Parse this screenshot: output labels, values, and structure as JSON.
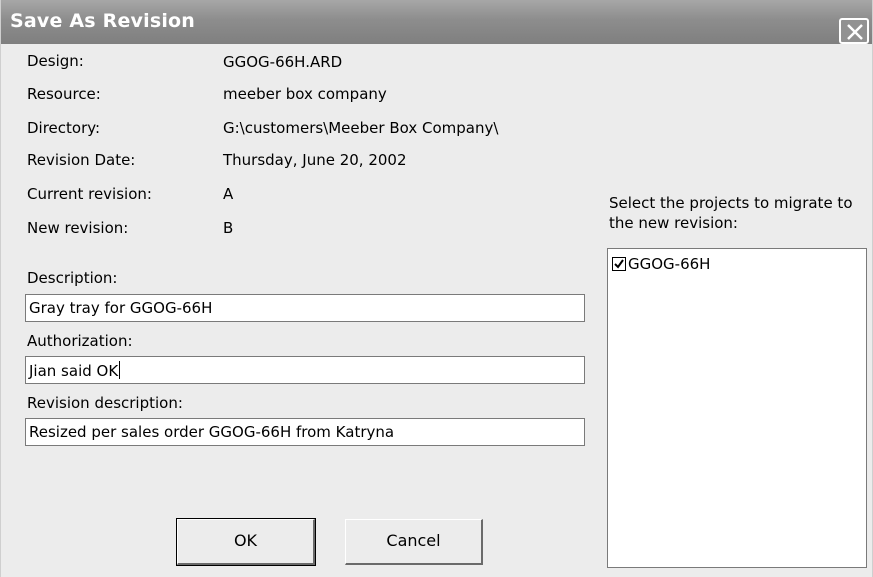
{
  "window": {
    "title": "Save As Revision",
    "close_icon": "close-icon"
  },
  "info": {
    "design_label": "Design:",
    "design_value": "GGOG-66H.ARD",
    "resource_label": "Resource:",
    "resource_value": "meeber box company",
    "directory_label": "Directory:",
    "directory_value": "G:\\customers\\Meeber Box Company\\",
    "revision_date_label": "Revision Date:",
    "revision_date_value": "Thursday, June 20, 2002",
    "current_revision_label": "Current revision:",
    "current_revision_value": "A",
    "new_revision_label": "New revision:",
    "new_revision_value": "B"
  },
  "fields": {
    "description_label": "Description:",
    "description_value": "Gray tray for GGOG-66H",
    "authorization_label": "Authorization:",
    "authorization_value": "Jian said OK",
    "revision_description_label": "Revision description:",
    "revision_description_value": "Resized per sales order GGOG-66H from Katryna"
  },
  "buttons": {
    "ok_label": "OK",
    "cancel_label": "Cancel"
  },
  "projects": {
    "caption": "Select the projects to migrate to the new revision:",
    "items": [
      {
        "label": "GGOG-66H",
        "checked": true
      }
    ]
  },
  "colors": {
    "titlebar": "#8d8d8d",
    "dialog_background": "#ececec"
  }
}
